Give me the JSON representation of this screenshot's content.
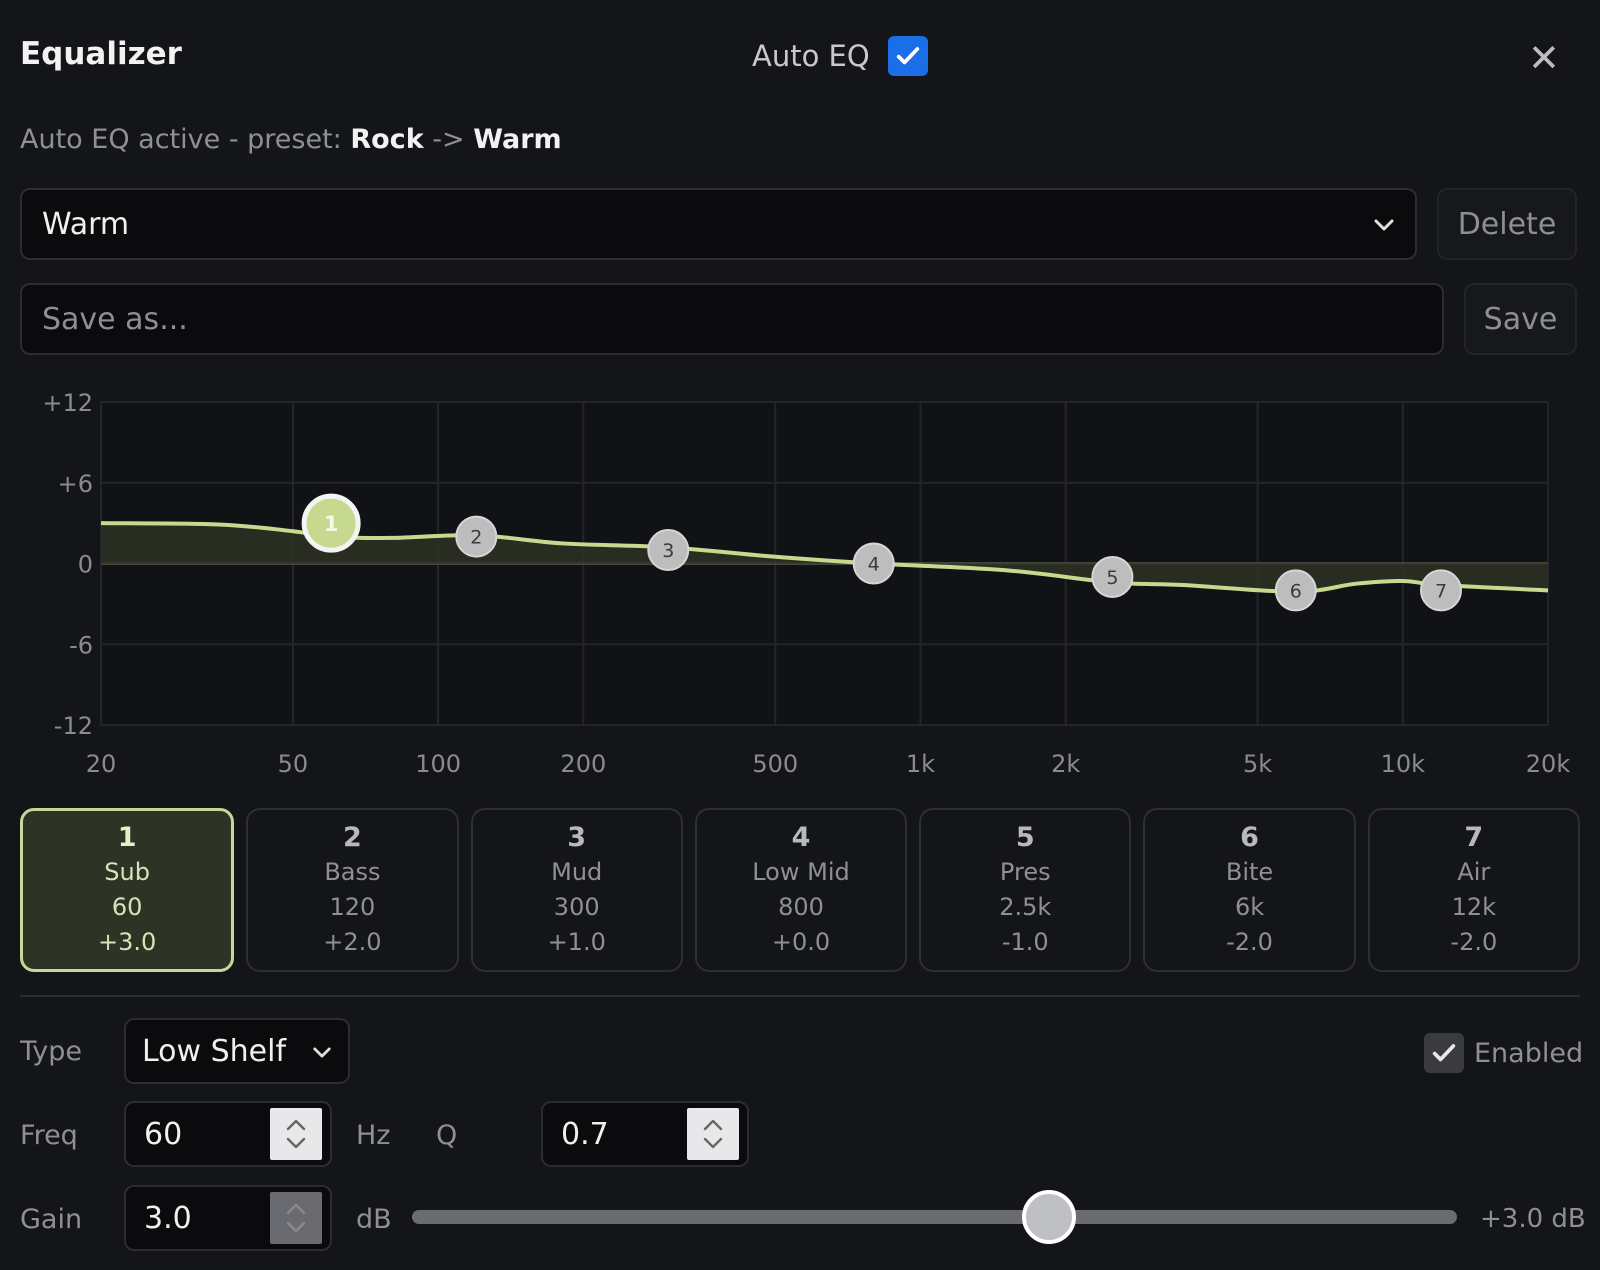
{
  "header": {
    "title": "Equalizer",
    "auto_eq_label": "Auto EQ",
    "auto_eq_checked": true,
    "close_glyph": "✕"
  },
  "status": {
    "prefix": "Auto EQ active - preset: ",
    "from_preset": "Rock",
    "arrow": " -> ",
    "to_preset": "Warm"
  },
  "preset": {
    "selected": "Warm",
    "delete_label": "Delete",
    "save_placeholder": "Save as...",
    "save_label": "Save"
  },
  "chart_data": {
    "type": "line",
    "title": "",
    "xlabel": "",
    "ylabel": "",
    "x_scale": "log",
    "xlim": [
      20,
      20000
    ],
    "ylim": [
      -12,
      12
    ],
    "x_ticks": [
      {
        "v": 20,
        "label": "20"
      },
      {
        "v": 50,
        "label": "50"
      },
      {
        "v": 100,
        "label": "100"
      },
      {
        "v": 200,
        "label": "200"
      },
      {
        "v": 500,
        "label": "500"
      },
      {
        "v": 1000,
        "label": "1k"
      },
      {
        "v": 2000,
        "label": "2k"
      },
      {
        "v": 5000,
        "label": "5k"
      },
      {
        "v": 10000,
        "label": "10k"
      },
      {
        "v": 20000,
        "label": "20k"
      }
    ],
    "y_ticks": [
      {
        "v": 12,
        "label": "+12"
      },
      {
        "v": 6,
        "label": "+6"
      },
      {
        "v": 0,
        "label": "0"
      },
      {
        "v": -6,
        "label": "-6"
      },
      {
        "v": -12,
        "label": "-12"
      }
    ],
    "grid": true,
    "response_curve": [
      {
        "x": 20,
        "y": 3.0
      },
      {
        "x": 35,
        "y": 2.9
      },
      {
        "x": 50,
        "y": 2.4
      },
      {
        "x": 60,
        "y": 2.0
      },
      {
        "x": 80,
        "y": 1.9
      },
      {
        "x": 120,
        "y": 2.1
      },
      {
        "x": 180,
        "y": 1.5
      },
      {
        "x": 300,
        "y": 1.2
      },
      {
        "x": 500,
        "y": 0.5
      },
      {
        "x": 800,
        "y": 0.0
      },
      {
        "x": 1500,
        "y": -0.5
      },
      {
        "x": 2500,
        "y": -1.4
      },
      {
        "x": 3500,
        "y": -1.6
      },
      {
        "x": 6000,
        "y": -2.1
      },
      {
        "x": 8000,
        "y": -1.5
      },
      {
        "x": 10000,
        "y": -1.3
      },
      {
        "x": 12000,
        "y": -1.6
      },
      {
        "x": 20000,
        "y": -2.0
      }
    ],
    "band_points": [
      {
        "label": "1",
        "x": 60,
        "y": 3.0,
        "active": true
      },
      {
        "label": "2",
        "x": 120,
        "y": 2.0
      },
      {
        "label": "3",
        "x": 300,
        "y": 1.0
      },
      {
        "label": "4",
        "x": 800,
        "y": 0.0
      },
      {
        "label": "5",
        "x": 2500,
        "y": -1.0
      },
      {
        "label": "6",
        "x": 6000,
        "y": -2.0
      },
      {
        "label": "7",
        "x": 12000,
        "y": -2.0
      }
    ],
    "colors": {
      "curve": "#c7d98f",
      "fill": "#2e3323",
      "point": "#bdbdbd",
      "active_point": "#c7d98f"
    }
  },
  "bands": [
    {
      "num": "1",
      "name": "Sub",
      "freq": "60",
      "gain": "+3.0",
      "active": true
    },
    {
      "num": "2",
      "name": "Bass",
      "freq": "120",
      "gain": "+2.0"
    },
    {
      "num": "3",
      "name": "Mud",
      "freq": "300",
      "gain": "+1.0"
    },
    {
      "num": "4",
      "name": "Low Mid",
      "freq": "800",
      "gain": "+0.0"
    },
    {
      "num": "5",
      "name": "Pres",
      "freq": "2.5k",
      "gain": "-1.0"
    },
    {
      "num": "6",
      "name": "Bite",
      "freq": "6k",
      "gain": "-2.0"
    },
    {
      "num": "7",
      "name": "Air",
      "freq": "12k",
      "gain": "-2.0"
    }
  ],
  "editor": {
    "type_label": "Type",
    "type_value": "Low Shelf",
    "enabled_label": "Enabled",
    "enabled_checked": true,
    "freq_label": "Freq",
    "freq_value": "60",
    "freq_unit": "Hz",
    "q_label": "Q",
    "q_value": "0.7",
    "gain_label": "Gain",
    "gain_value": "3.0",
    "gain_unit": "dB",
    "gain_readout": "+3.0 dB",
    "gain_slider_fraction": 0.61
  },
  "icons": {
    "check": "check-icon",
    "chevron": "chevron-down-icon",
    "close": "close-icon",
    "spin": "spin-arrows-icon"
  }
}
